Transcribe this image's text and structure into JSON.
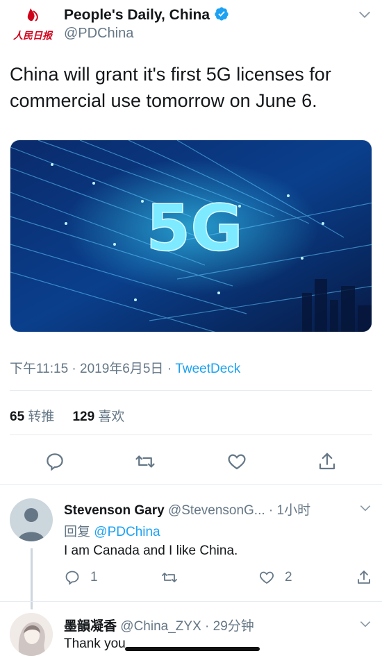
{
  "tweet": {
    "author_name": "People's Daily, China",
    "author_handle": "@PDChina",
    "logo_text": "人民日报",
    "text": "China will grant it's first 5G licenses for commercial use tomorrow on June 6.",
    "media_text": "5G",
    "time": "下午11:15",
    "date": "2019年6月5日",
    "source": "TweetDeck",
    "retweet_count": "65",
    "retweet_label": "转推",
    "like_count": "129",
    "like_label": "喜欢"
  },
  "replies": [
    {
      "name": "Stevenson Gary",
      "handle": "@StevensonG...",
      "time": "1小时",
      "replying_label": "回复",
      "replying_to": "@PDChina",
      "text": "I am Canada and I like China.",
      "reply_count": "1",
      "like_count": "2"
    },
    {
      "name": "墨韻凝香",
      "handle": "@China_ZYX",
      "time": "29分钟",
      "text": "Thank you"
    }
  ],
  "colors": {
    "link": "#1da1f2",
    "secondary": "#657786",
    "primary": "#14171a"
  },
  "icons": {
    "logo": "peoples-daily-logo",
    "verified": "verified-badge-icon",
    "reply": "reply-icon",
    "retweet": "retweet-icon",
    "like": "heart-icon",
    "share": "share-icon",
    "more": "chevron-down-icon"
  }
}
